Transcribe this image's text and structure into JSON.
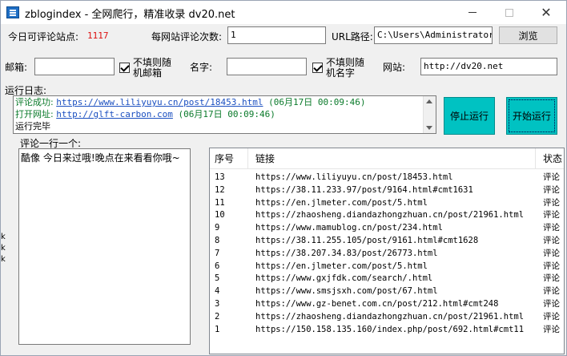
{
  "window": {
    "title": "zblogindex - 全网爬行，精准收录  dv20.net"
  },
  "stats": {
    "label": "今日可评论站点:",
    "value": "1117"
  },
  "per_site": {
    "label": "每网站评论次数:",
    "value": "1"
  },
  "url_path": {
    "label": "URL路径:",
    "value": "C:\\Users\\Administrator.W",
    "browse_label": "浏览"
  },
  "email": {
    "label": "邮箱:",
    "value": "",
    "random_label_line1": "不填则随",
    "random_label_line2": "机邮箱"
  },
  "name": {
    "label": "名字:",
    "value": "",
    "random_label_line1": "不填则随",
    "random_label_line2": "机名字"
  },
  "website": {
    "label": "网站:",
    "value": "http://dv20.net"
  },
  "log": {
    "label": "运行日志:",
    "lines": [
      {
        "prefix": "评论成功: ",
        "url": "https://www.liliyuyu.cn/post/18453.html",
        "time": " (06月17日 00:09:46)"
      },
      {
        "prefix": "打开网址: ",
        "url": "http://glft-carbon.com",
        "time": " (06月17日 00:09:46)"
      },
      {
        "prefix": "运行完毕",
        "url": "",
        "time": ""
      }
    ]
  },
  "buttons": {
    "stop": "停止运行",
    "start": "开始运行"
  },
  "comments": {
    "label": "评论一行一个:",
    "text": "酷像 今日来过哦!晚点在来看看你哦~"
  },
  "table": {
    "headers": [
      "序号",
      "链接",
      "状态"
    ],
    "rows": [
      {
        "id": "13",
        "url": "https://www.liliyuyu.cn/post/18453.html",
        "status": "评论"
      },
      {
        "id": "12",
        "url": "https://38.11.233.97/post/9164.html#cmt1631",
        "status": "评论"
      },
      {
        "id": "11",
        "url": "https://en.jlmeter.com/post/5.html",
        "status": "评论"
      },
      {
        "id": "10",
        "url": "https://zhaosheng.diandazhongzhuan.cn/post/21961.html",
        "status": "评论"
      },
      {
        "id": "9",
        "url": "https://www.mamublog.cn/post/234.html",
        "status": "评论"
      },
      {
        "id": "8",
        "url": "https://38.11.255.105/post/9161.html#cmt1628",
        "status": "评论"
      },
      {
        "id": "7",
        "url": "https://38.207.34.83/post/26773.html",
        "status": "评论"
      },
      {
        "id": "6",
        "url": "https://en.jlmeter.com/post/5.html",
        "status": "评论"
      },
      {
        "id": "5",
        "url": "https://www.gxjfdk.com/search/.html",
        "status": "评论"
      },
      {
        "id": "4",
        "url": "https://www.smsjsxh.com/post/67.html",
        "status": "评论"
      },
      {
        "id": "3",
        "url": "https://www.gz-benet.com.cn/post/212.html#cmt248",
        "status": "评论"
      },
      {
        "id": "2",
        "url": "https://zhaosheng.diandazhongzhuan.cn/post/21961.html",
        "status": "评论"
      },
      {
        "id": "1",
        "url": "https://150.158.135.160/index.php/post/692.html#cmt11",
        "status": "评论"
      }
    ]
  },
  "colors": {
    "accent": "#00c2c2",
    "count": "#dd1111",
    "log_green": "#0a7a2a",
    "link": "#1a4fc0"
  }
}
